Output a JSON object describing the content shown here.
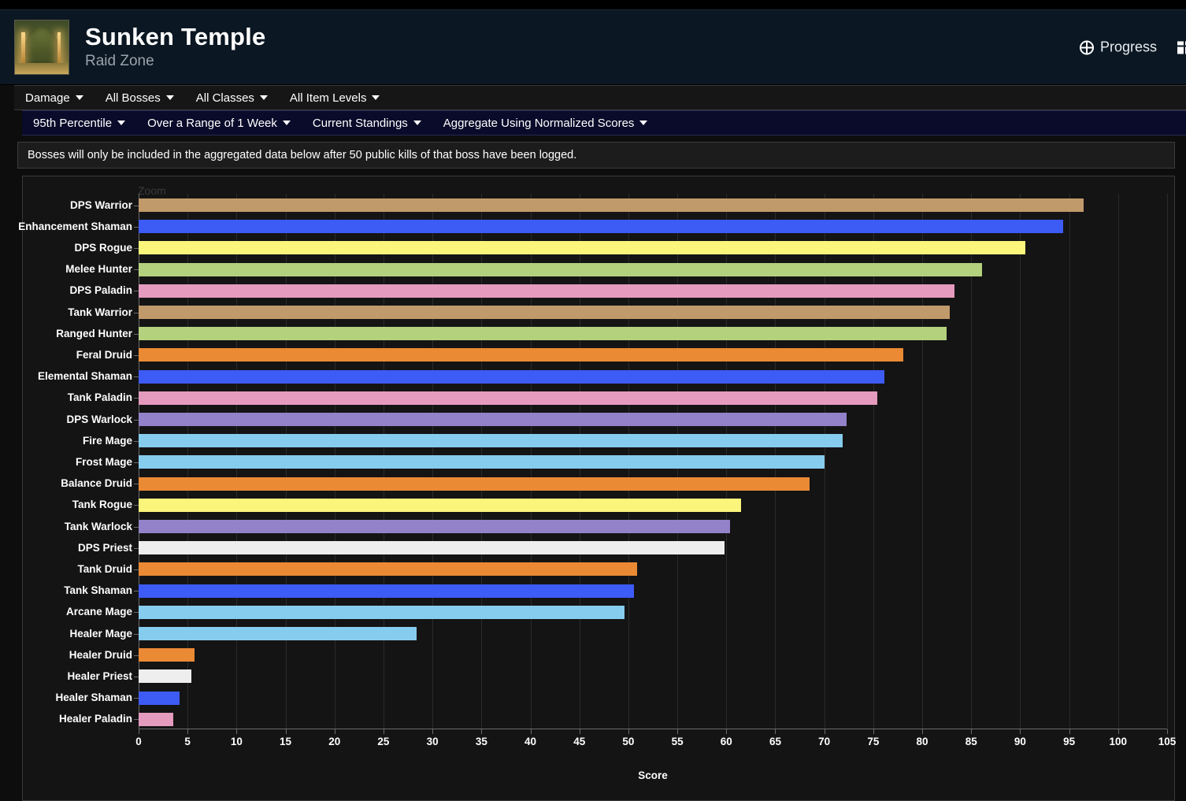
{
  "header": {
    "title": "Sunken Temple",
    "subtitle": "Raid Zone",
    "progress_label": "Progress",
    "icon_name": "sunken-temple-zone-icon"
  },
  "filters_primary": [
    {
      "label": "Damage"
    },
    {
      "label": "All Bosses"
    },
    {
      "label": "All Classes"
    },
    {
      "label": "All Item Levels"
    }
  ],
  "filters_secondary": [
    {
      "label": "95th Percentile"
    },
    {
      "label": "Over a Range of 1 Week"
    },
    {
      "label": "Current Standings"
    },
    {
      "label": "Aggregate Using Normalized Scores"
    }
  ],
  "notice": "Bosses will only be included in the aggregated data below after 50 public kills of that boss have been logged.",
  "chart_controls": {
    "zoom_label": "Zoom"
  },
  "colors": {
    "warrior": "#C19A6B",
    "shaman": "#3D5BF5",
    "rogue": "#FBF57C",
    "hunter": "#B4D17D",
    "paladin": "#E49BBE",
    "druid": "#EB8A35",
    "warlock": "#9382C9",
    "mage": "#86CCEE",
    "priest": "#EEEEEE",
    "panel_bg": "#141414",
    "page_bg": "#0d0d0d",
    "header_bg": "#0b1722",
    "accent_bar_bg": "#0a0a2a"
  },
  "chart_data": {
    "type": "bar",
    "orientation": "horizontal",
    "title": "",
    "xlabel": "Score",
    "ylabel": "",
    "xlim": [
      0,
      105
    ],
    "xticks": [
      0,
      5,
      10,
      15,
      20,
      25,
      30,
      35,
      40,
      45,
      50,
      55,
      60,
      65,
      70,
      75,
      80,
      85,
      90,
      95,
      100,
      105
    ],
    "grid": true,
    "legend": "none",
    "categories": [
      "DPS Warrior",
      "Enhancement Shaman",
      "DPS Rogue",
      "Melee Hunter",
      "DPS Paladin",
      "Tank Warrior",
      "Ranged Hunter",
      "Feral Druid",
      "Elemental Shaman",
      "Tank Paladin",
      "DPS Warlock",
      "Fire Mage",
      "Frost Mage",
      "Balance Druid",
      "Tank Rogue",
      "Tank Warlock",
      "DPS Priest",
      "Tank Druid",
      "Tank Shaman",
      "Arcane Mage",
      "Healer Mage",
      "Healer Druid",
      "Healer Priest",
      "Healer Shaman",
      "Healer Paladin"
    ],
    "values": [
      96.5,
      94.4,
      90.5,
      86.1,
      83.3,
      82.8,
      82.5,
      78.1,
      76.1,
      75.4,
      72.3,
      71.9,
      70.0,
      68.5,
      61.5,
      60.4,
      59.8,
      50.9,
      50.6,
      49.6,
      28.4,
      5.7,
      5.4,
      4.2,
      3.5
    ],
    "bar_colors": [
      "#C19A6B",
      "#3D5BF5",
      "#FBF57C",
      "#B4D17D",
      "#E49BBE",
      "#C19A6B",
      "#B4D17D",
      "#EB8A35",
      "#3D5BF5",
      "#E49BBE",
      "#9382C9",
      "#86CCEE",
      "#86CCEE",
      "#EB8A35",
      "#FBF57C",
      "#9382C9",
      "#EEEEEE",
      "#EB8A35",
      "#3D5BF5",
      "#86CCEE",
      "#86CCEE",
      "#EB8A35",
      "#EEEEEE",
      "#3D5BF5",
      "#E49BBE"
    ]
  }
}
